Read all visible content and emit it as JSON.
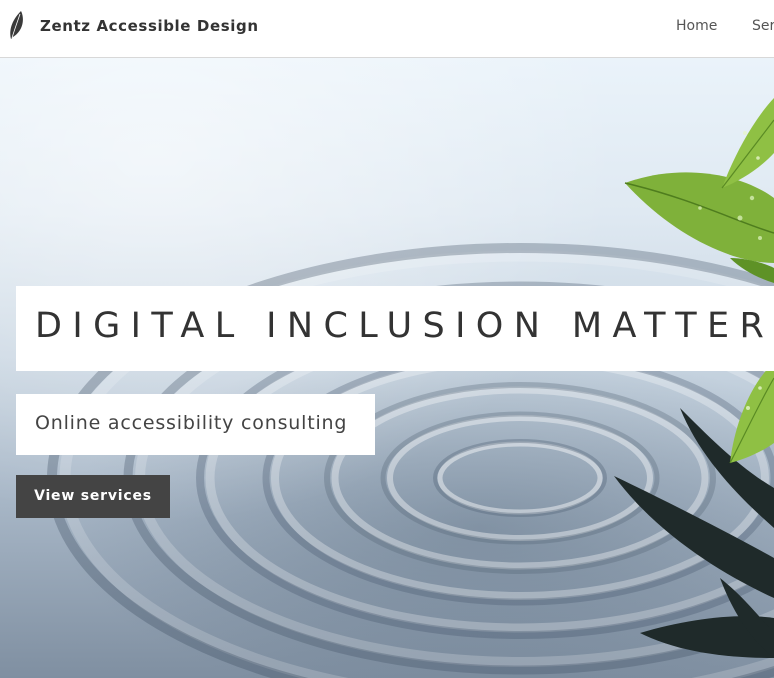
{
  "header": {
    "brand_name": "Zentz Accessible Design",
    "logo_icon": "leaf-icon",
    "nav": {
      "home": "Home",
      "services_partial": "Ser"
    }
  },
  "hero": {
    "title": "DIGITAL INCLUSION MATTERS",
    "subtitle": "Online accessibility consulting",
    "cta_label": "View services",
    "background_image": "water-ripples-with-green-leaves"
  },
  "colors": {
    "text_dark": "#333333",
    "button_bg": "#444444",
    "button_text": "#ffffff",
    "header_bg": "#ffffff",
    "leaf_green": "#7fb13a"
  }
}
